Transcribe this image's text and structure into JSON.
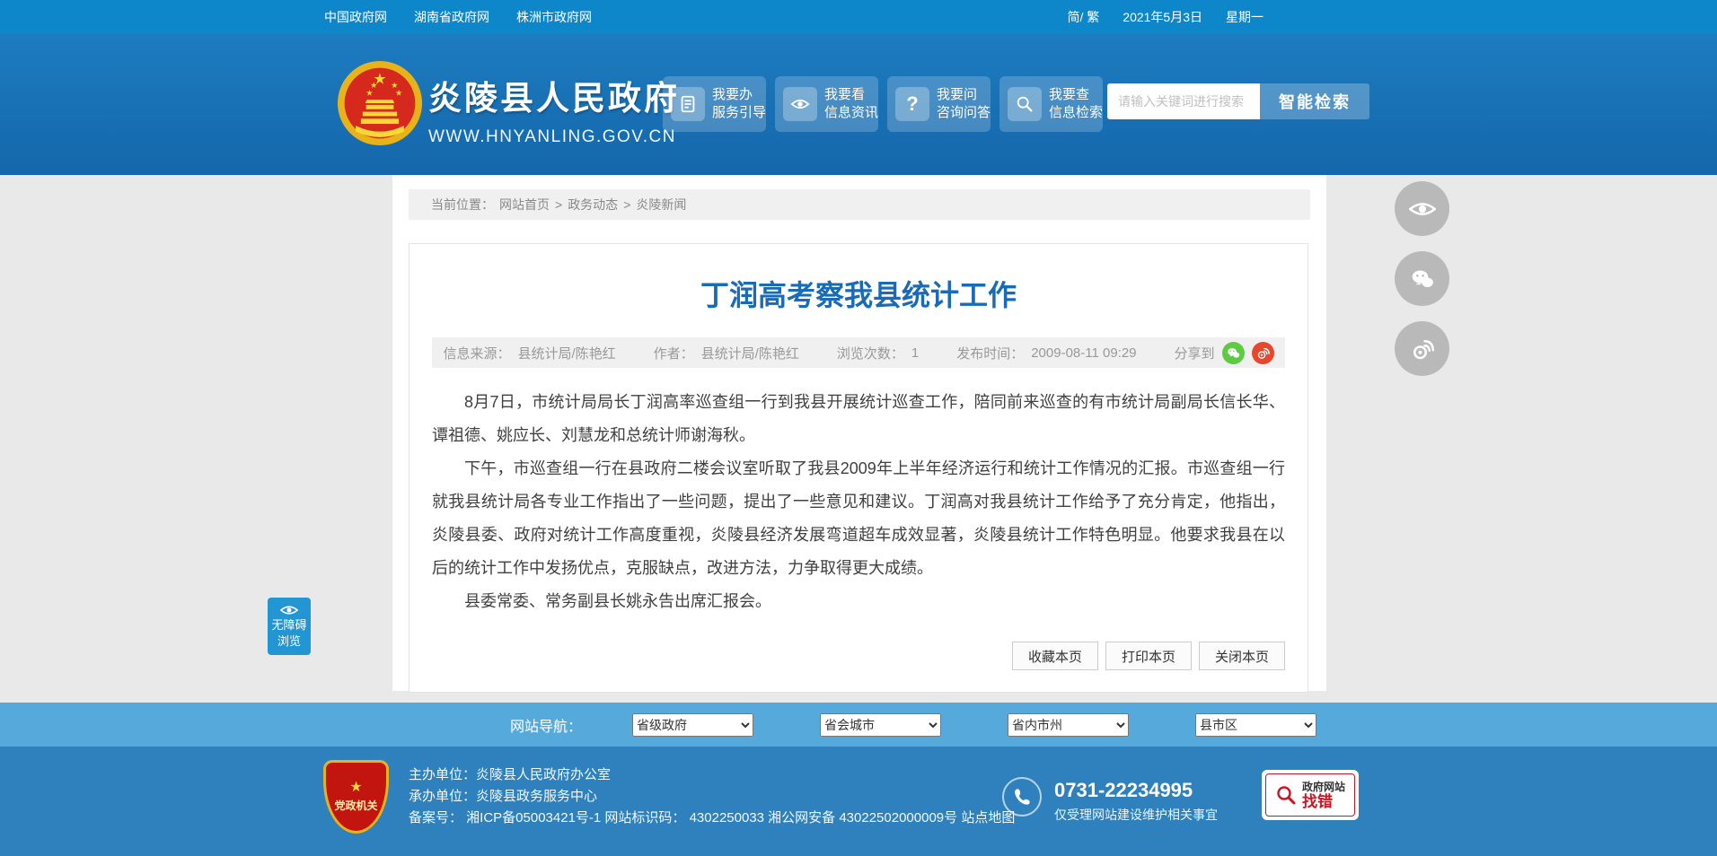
{
  "colors": {
    "topbar": "#0e87ca",
    "header": "#1870b4",
    "accent_title": "#1a6bb7",
    "nav_row": "#55aadb",
    "footer": "#2e81bd",
    "wechat_green": "#5ecb43",
    "weibo_red": "#e6482e",
    "badge_red": "#cf1322"
  },
  "topbar": {
    "links": [
      "中国政府网",
      "湖南省政府网",
      "株洲市政府网"
    ],
    "lang_toggle": "简/ 繁",
    "date": "2021年5月3日",
    "weekday": "星期一"
  },
  "header": {
    "site_name": "炎陵县人民政府",
    "site_url": "WWW.HNYANLING.GOV.CN",
    "quick_buttons": [
      {
        "icon": "document-icon",
        "line1": "我要办",
        "line2": "服务引导"
      },
      {
        "icon": "eye-icon",
        "line1": "我要看",
        "line2": "信息资讯"
      },
      {
        "icon": "question-icon",
        "line1": "我要问",
        "line2": "咨询问答"
      },
      {
        "icon": "search-icon",
        "line1": "我要查",
        "line2": "信息检索"
      }
    ],
    "search": {
      "placeholder": "请输入关键词进行搜索",
      "button": "智能检索"
    }
  },
  "breadcrumb": {
    "label": "当前位置：",
    "items": [
      "网站首页",
      "政务动态",
      "炎陵新闻"
    ],
    "separator": ">"
  },
  "article": {
    "title": "丁润高考察我县统计工作",
    "meta": {
      "source_label": "信息来源：",
      "source": "县统计局/陈艳红",
      "author_label": "作者：",
      "author": "县统计局/陈艳红",
      "views_label": "浏览次数：",
      "views": "1",
      "publish_label": "发布时间：",
      "publish_time": "2009-08-11 09:29",
      "share_label": "分享到",
      "share_icons": [
        "wechat-icon",
        "weibo-icon"
      ]
    },
    "paragraphs": [
      "8月7日，市统计局局长丁润高率巡查组一行到我县开展统计巡查工作，陪同前来巡查的有市统计局副局长信长华、谭祖德、姚应长、刘慧龙和总统计师谢海秋。",
      "下午，市巡查组一行在县政府二楼会议室听取了我县2009年上半年经济运行和统计工作情况的汇报。市巡查组一行就我县统计局各专业工作指出了一些问题，提出了一些意见和建议。丁润高对我县统计工作给予了充分肯定，他指出，炎陵县委、政府对统计工作高度重视，炎陵县经济发展弯道超车成效显著，炎陵县统计工作特色明显。他要求我县在以后的统计工作中发扬优点，克服缺点，改进方法，力争取得更大成绩。",
      "县委常委、常务副县长姚永告出席汇报会。"
    ],
    "actions": [
      "收藏本页",
      "打印本页",
      "关闭本页"
    ]
  },
  "sitenav": {
    "label": "网站导航：",
    "selects": [
      "省级政府",
      "省会城市",
      "省内市州",
      "县市区"
    ]
  },
  "footer": {
    "shield_star": "★",
    "shield_text": "党政机关",
    "host_label": "主办单位：",
    "host": "炎陵县人民政府办公室",
    "organizer_label": "承办单位：",
    "organizer": "炎陵县政务服务中心",
    "icp_line": "备案号： 湘ICP备05003421号-1 网站标识码： 4302250033 湘公网安备 43022502000009号",
    "sitemap": "站点地图",
    "phone": "0731-22234995",
    "phone_note": "仅受理网站建设维护相关事宜",
    "error_badge_line1": "政府网站",
    "error_badge_line2": "找错"
  },
  "floating": {
    "accessibility_line1": "无障碍",
    "accessibility_line2": "浏览",
    "right_icons": [
      "eye-icon",
      "wechat-icon",
      "weibo-icon"
    ]
  }
}
